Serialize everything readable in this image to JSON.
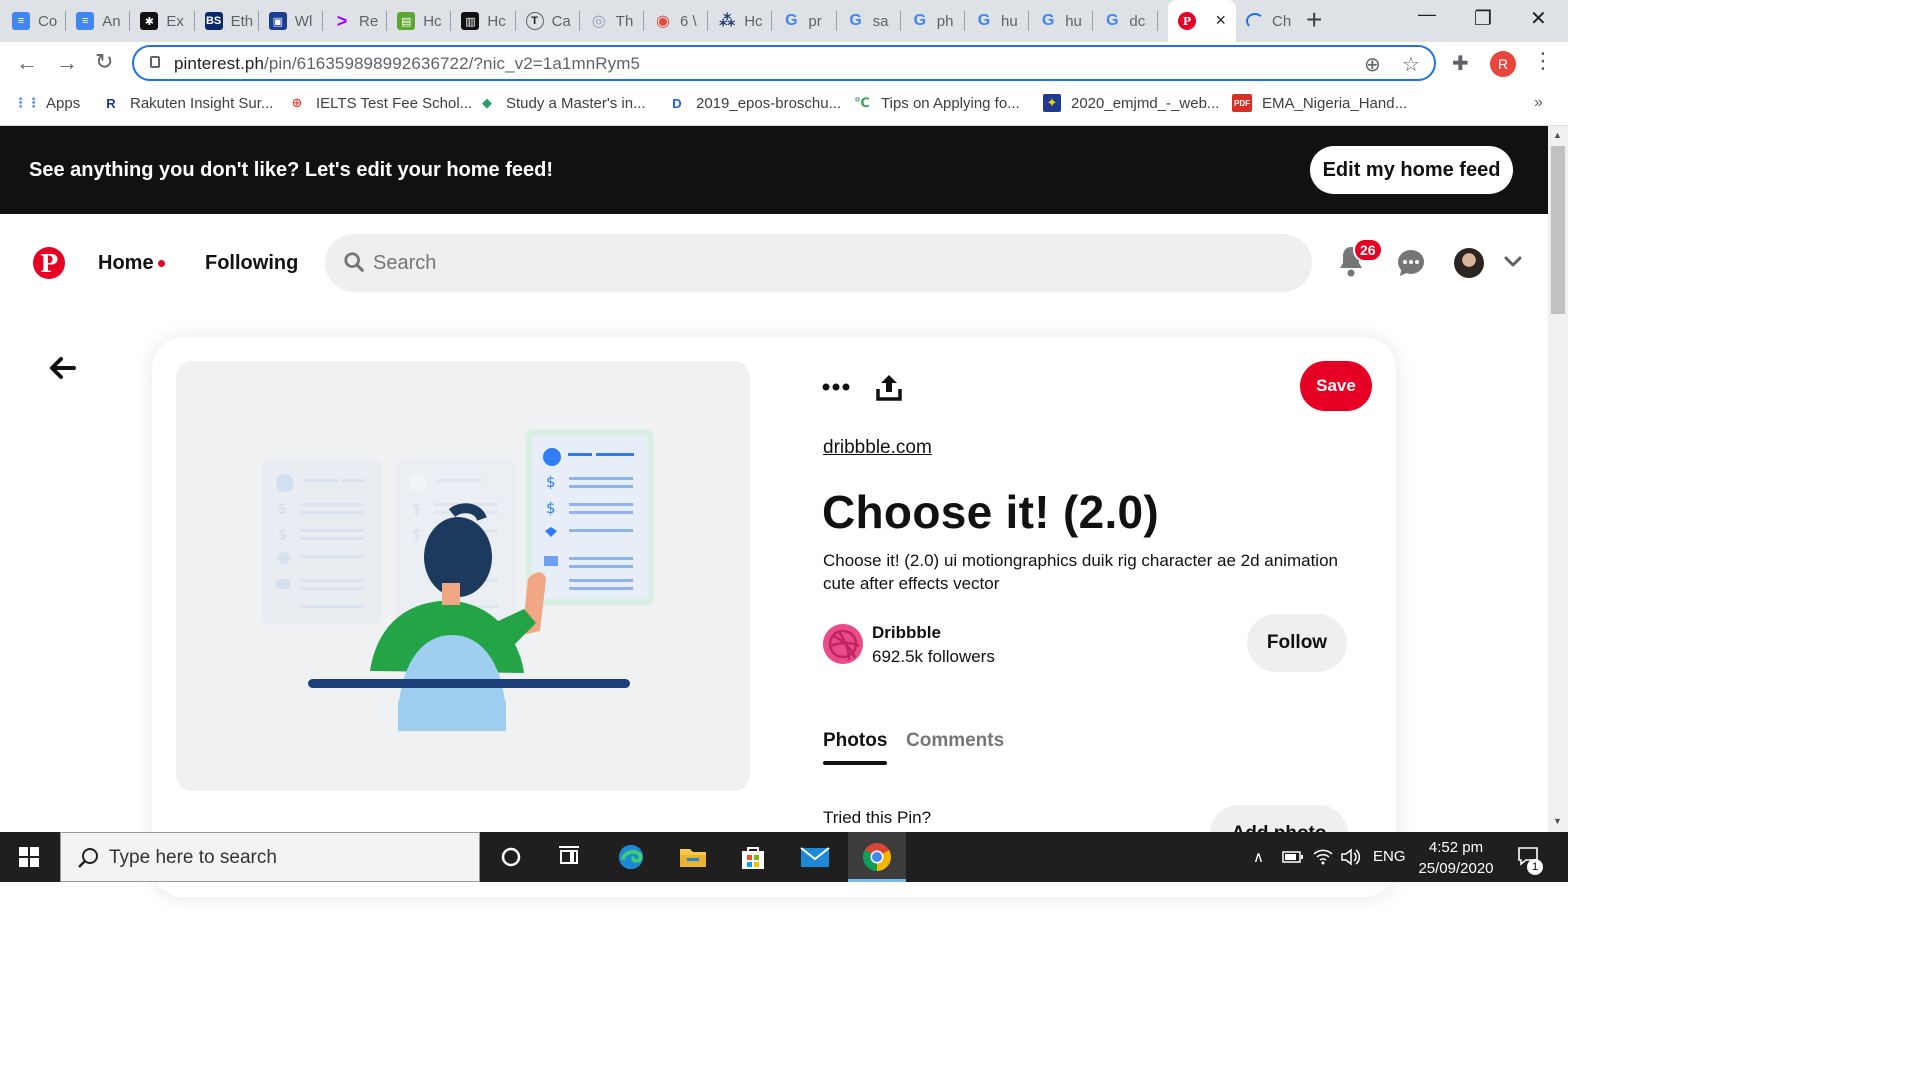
{
  "browser": {
    "tabs": [
      {
        "title": "Co",
        "icon": "google-docs-icon",
        "color": "#4285f4",
        "glyph": "≡"
      },
      {
        "title": "An",
        "icon": "google-docs-icon",
        "color": "#4285f4",
        "glyph": "≡"
      },
      {
        "title": "Ex",
        "icon": "asterisk-logo-icon",
        "color": "#111111",
        "glyph": "✱"
      },
      {
        "title": "Eth",
        "icon": "bs-logo-icon",
        "color": "#0b2a6b",
        "glyph": "BS"
      },
      {
        "title": "Wl",
        "icon": "chat-logo-icon",
        "color": "#1c3f94",
        "glyph": "▣"
      },
      {
        "title": "Re",
        "icon": "accenture-logo-icon",
        "color": "#ffffff",
        "glyph": ">"
      },
      {
        "title": "Hc",
        "icon": "green-logo-icon",
        "color": "#5aa832",
        "glyph": "▤"
      },
      {
        "title": "Hc",
        "icon": "dark-logo-icon",
        "color": "#111111",
        "glyph": "▥"
      },
      {
        "title": "Ca",
        "icon": "t-logo-icon",
        "color": "#ffffff",
        "glyph": "T"
      },
      {
        "title": "Th",
        "icon": "globe-logo-icon",
        "color": "#ffffff",
        "glyph": "◎"
      },
      {
        "title": "6 \\",
        "icon": "globe-red-icon",
        "color": "#ffffff",
        "glyph": "◉"
      },
      {
        "title": "Hc",
        "icon": "slack-logo-icon",
        "color": "#ffffff",
        "glyph": "⁂"
      },
      {
        "title": "pr",
        "icon": "google-icon",
        "color": "#ffffff",
        "glyph": "G"
      },
      {
        "title": "sa",
        "icon": "google-icon",
        "color": "#ffffff",
        "glyph": "G"
      },
      {
        "title": "ph",
        "icon": "google-icon",
        "color": "#ffffff",
        "glyph": "G"
      },
      {
        "title": "hu",
        "icon": "google-icon",
        "color": "#ffffff",
        "glyph": "G"
      },
      {
        "title": "hu",
        "icon": "google-icon",
        "color": "#ffffff",
        "glyph": "G"
      },
      {
        "title": "dc",
        "icon": "google-icon",
        "color": "#ffffff",
        "glyph": "G"
      }
    ],
    "active_tab": {
      "icon": "pinterest-icon",
      "close": "×"
    },
    "last_tab": {
      "title": "Ch",
      "icon": "loading-icon"
    },
    "new_tab": "+",
    "window_controls": {
      "minimize": "—",
      "restore": "❐",
      "close": "✕"
    },
    "url_host": "pinterest.ph",
    "url_path": "/pin/616359898992636722/?nic_v2=1a1mnRym5",
    "profile_initial": "R",
    "bookmarks": [
      {
        "label": "Apps",
        "icon": "apps-grid-icon",
        "glyph": "⋮⋮",
        "color": "#4285f4",
        "bg": "transparent"
      },
      {
        "label": "Rakuten Insight Sur...",
        "icon": "rakuten-r-icon",
        "glyph": "R",
        "color": "#1a3a8f",
        "bg": "transparent"
      },
      {
        "label": "IELTS Test Fee Schol...",
        "icon": "globe-red-icon",
        "glyph": "⊕",
        "color": "#e8453c",
        "bg": "transparent"
      },
      {
        "label": "Study a Master's in...",
        "icon": "cube-icon",
        "glyph": "◆",
        "color": "#2e9e6a",
        "bg": "transparent"
      },
      {
        "label": "2019_epos-broschu...",
        "icon": "d-logo-icon",
        "glyph": "D",
        "color": "#1a62d6",
        "bg": "transparent"
      },
      {
        "label": "Tips on Applying fo...",
        "icon": "oc-logo-icon",
        "glyph": "℃",
        "color": "#3aa35a",
        "bg": "transparent"
      },
      {
        "label": "2020_emjmd_-_web...",
        "icon": "eu-flag-icon",
        "glyph": "✦",
        "color": "#f5d000",
        "bg": "#1f3a93"
      },
      {
        "label": "EMA_Nigeria_Hand...",
        "icon": "pdf-icon",
        "glyph": "PDF",
        "color": "#ffffff",
        "bg": "#d93025"
      }
    ],
    "bookmarks_overflow": "»"
  },
  "banner": {
    "text": "See anything you don't like? Let's edit your home feed!",
    "button": "Edit my home feed"
  },
  "header": {
    "logo": "P",
    "home": "Home",
    "following": "Following",
    "search_placeholder": "Search",
    "notifications_count": "26"
  },
  "pin": {
    "source": "dribbble.com",
    "title": "Choose it! (2.0)",
    "description": "Choose it! (2.0) ui motiongraphics duik rig character ae 2d animation cute after effects vector",
    "save": "Save",
    "creator_name": "Dribbble",
    "creator_followers": "692.5k followers",
    "follow": "Follow",
    "tabs": {
      "photos": "Photos",
      "comments": "Comments"
    },
    "tried": "Tried this Pin?",
    "add_photo": "Add photo",
    "illustration": {
      "icon": "illustration-person-choosing-card",
      "accent": "#2e7df6",
      "shirt": "#22a447",
      "chair": "#9ecff0",
      "hair": "#1c3a5e",
      "desk": "#1c3f7a"
    }
  },
  "taskbar": {
    "search_text": "Type here to search",
    "tray_lang": "ENG",
    "time": "4:52 pm",
    "date": "25/09/2020",
    "notifications": "1"
  },
  "colors": {
    "pinterest_red": "#e60023",
    "dark_banner": "#111111",
    "pill_grey": "#efefef"
  }
}
